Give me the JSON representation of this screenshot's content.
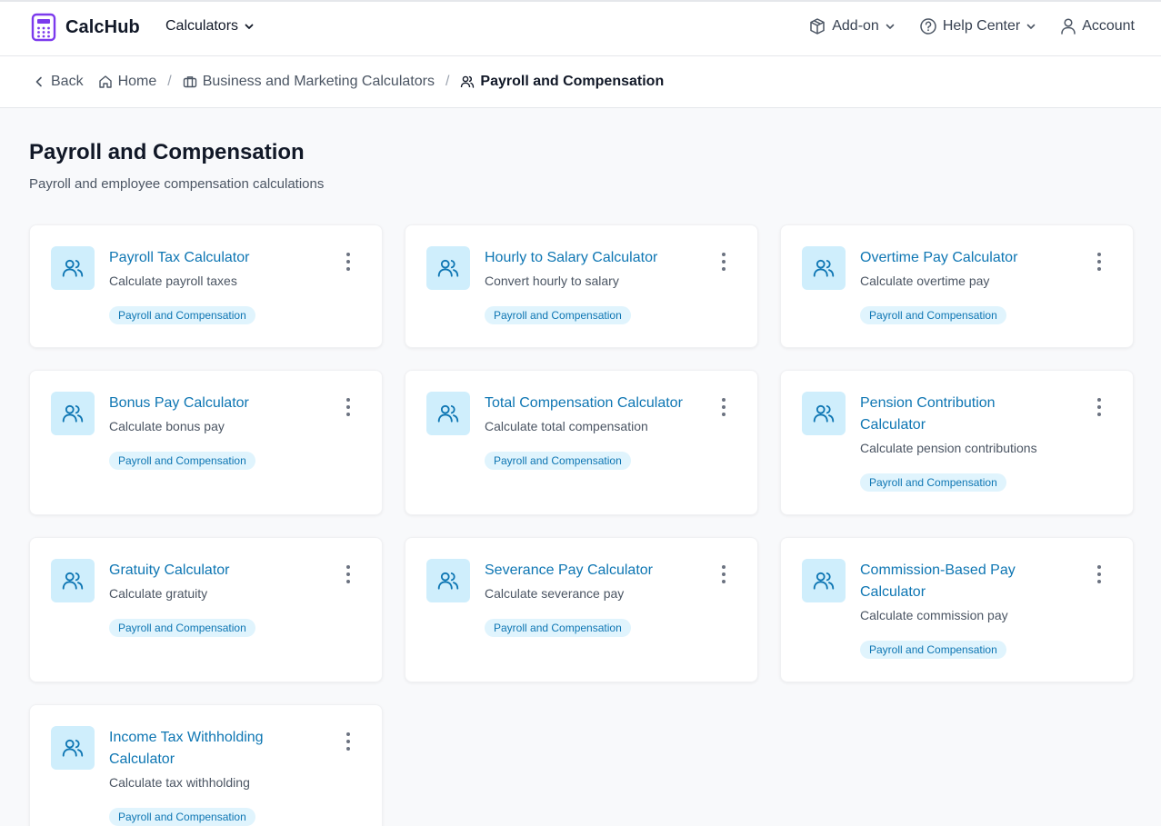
{
  "header": {
    "brand": "CalcHub",
    "calculators_label": "Calculators",
    "addon_label": "Add-on",
    "help_label": "Help Center",
    "account_label": "Account"
  },
  "breadcrumb": {
    "back": "Back",
    "home": "Home",
    "category": "Business and Marketing Calculators",
    "current": "Payroll and Compensation"
  },
  "page": {
    "title": "Payroll and Compensation",
    "subtitle": "Payroll and employee compensation calculations"
  },
  "colors": {
    "accent": "#0e76b3",
    "icon_bg": "#cfeefc",
    "tag_bg": "#e0f4fd",
    "brand": "#7c3aed"
  },
  "cards": [
    {
      "title": "Payroll Tax Calculator",
      "desc": "Calculate payroll taxes",
      "tag": "Payroll and Compensation",
      "icon": "users-icon"
    },
    {
      "title": "Hourly to Salary Calculator",
      "desc": "Convert hourly to salary",
      "tag": "Payroll and Compensation",
      "icon": "users-icon"
    },
    {
      "title": "Overtime Pay Calculator",
      "desc": "Calculate overtime pay",
      "tag": "Payroll and Compensation",
      "icon": "users-icon"
    },
    {
      "title": "Bonus Pay Calculator",
      "desc": "Calculate bonus pay",
      "tag": "Payroll and Compensation",
      "icon": "users-icon"
    },
    {
      "title": "Total Compensation Calculator",
      "desc": "Calculate total compensation",
      "tag": "Payroll and Compensation",
      "icon": "users-icon"
    },
    {
      "title": "Pension Contribution Calculator",
      "desc": "Calculate pension contributions",
      "tag": "Payroll and Compensation",
      "icon": "users-icon"
    },
    {
      "title": "Gratuity Calculator",
      "desc": "Calculate gratuity",
      "tag": "Payroll and Compensation",
      "icon": "users-icon"
    },
    {
      "title": "Severance Pay Calculator",
      "desc": "Calculate severance pay",
      "tag": "Payroll and Compensation",
      "icon": "users-icon"
    },
    {
      "title": "Commission-Based Pay Calculator",
      "desc": "Calculate commission pay",
      "tag": "Payroll and Compensation",
      "icon": "users-icon"
    },
    {
      "title": "Income Tax Withholding Calculator",
      "desc": "Calculate tax withholding",
      "tag": "Payroll and Compensation",
      "icon": "users-icon"
    }
  ]
}
